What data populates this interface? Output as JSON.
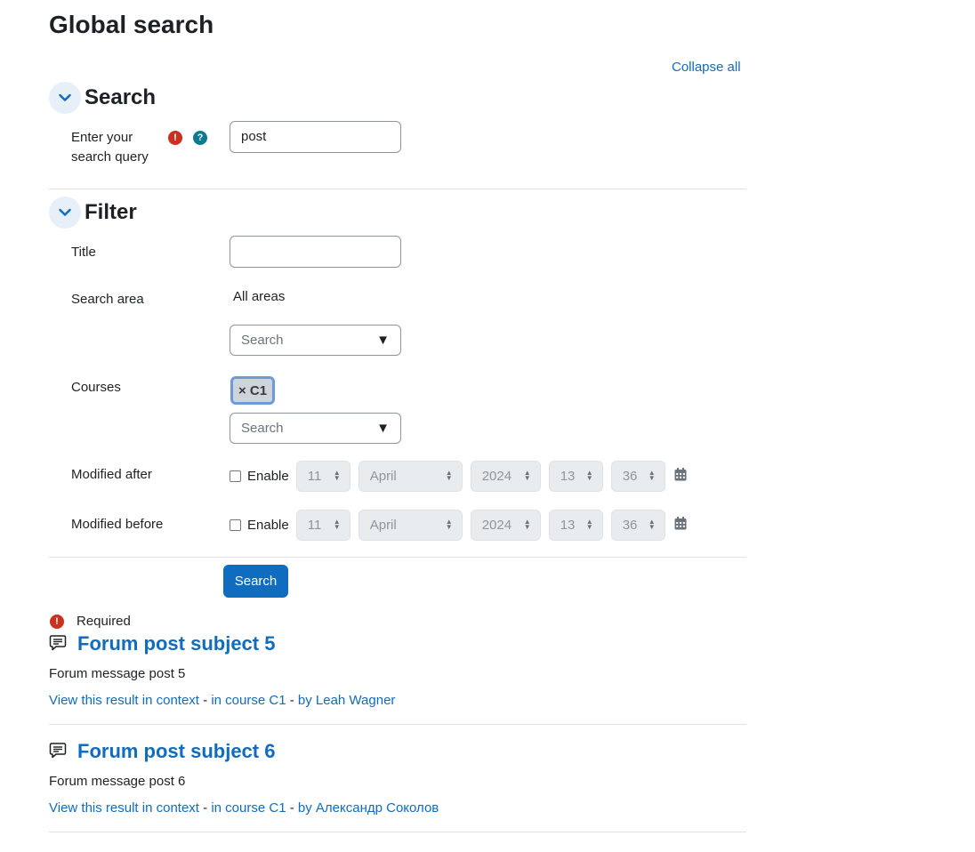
{
  "page": {
    "title": "Global search",
    "collapse_all": "Collapse all"
  },
  "search_section": {
    "title": "Search",
    "query_label_line1": "Enter your",
    "query_label_line2": "search query",
    "query_value": "post"
  },
  "filter_section": {
    "title": "Filter",
    "title_label": "Title",
    "title_value": "",
    "search_area_label": "Search area",
    "search_area_selected": "All areas",
    "search_area_placeholder": "Search",
    "courses_label": "Courses",
    "course_chip": "× C1",
    "courses_placeholder": "Search",
    "dropdown_arrow": "▼",
    "enable_label": "Enable",
    "modified_after": {
      "label": "Modified after",
      "day": "11",
      "month": "April",
      "year": "2024",
      "hour": "13",
      "minute": "36"
    },
    "modified_before": {
      "label": "Modified before",
      "day": "11",
      "month": "April",
      "year": "2024",
      "hour": "13",
      "minute": "36"
    }
  },
  "submit": {
    "label": "Search"
  },
  "required_note": "Required",
  "results": [
    {
      "title": "Forum post subject 5",
      "message": "Forum message post 5",
      "context_link": "View this result in context",
      "course_link": "in course C1",
      "author_link": "by Leah Wagner"
    },
    {
      "title": "Forum post subject 6",
      "message": "Forum message post 6",
      "context_link": "View this result in context",
      "course_link": "in course C1",
      "author_link": "by Александр Соколов"
    }
  ],
  "meta_separator": " - ",
  "colors": {
    "link": "#0f6cbf",
    "required": "#ca3120",
    "help": "#0f7a8f",
    "button": "#0f6cbf"
  }
}
